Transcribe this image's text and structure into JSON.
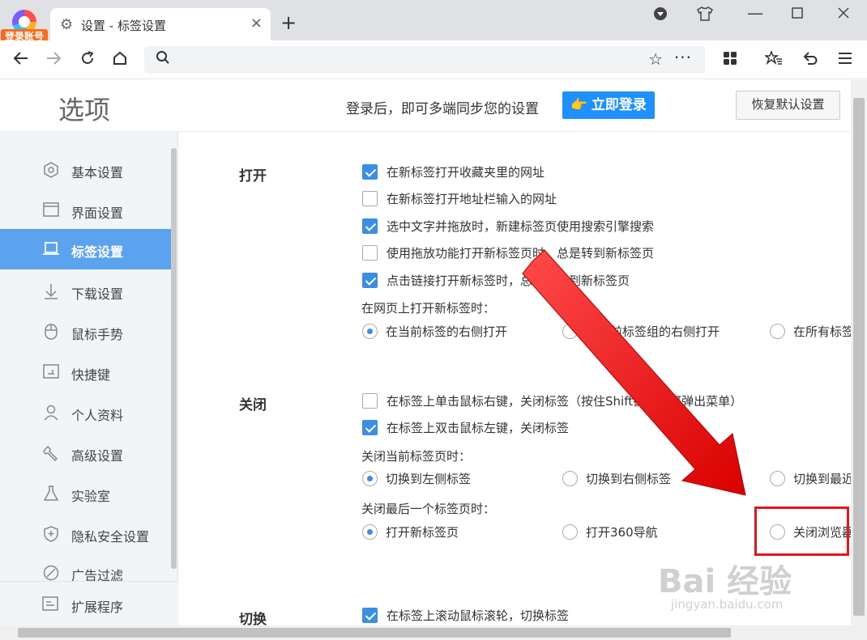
{
  "account": {
    "badge": "登录账号"
  },
  "tab": {
    "title": "设置 - 标签设置",
    "close": "×"
  },
  "newtab": "+",
  "header": {
    "title": "选项",
    "sync_text": "登录后，即可多端同步您的设置",
    "login_button": "👉 立即登录",
    "reset_button": "恢复默认设置"
  },
  "sidebar": {
    "items": [
      {
        "label": "基本设置",
        "icon": "hexagon-gear-icon"
      },
      {
        "label": "界面设置",
        "icon": "window-icon"
      },
      {
        "label": "标签设置",
        "icon": "tab-icon",
        "active": true
      },
      {
        "label": "下载设置",
        "icon": "download-icon"
      },
      {
        "label": "鼠标手势",
        "icon": "mouse-icon"
      },
      {
        "label": "快捷键",
        "icon": "keyboard-icon"
      },
      {
        "label": "个人资料",
        "icon": "person-icon"
      },
      {
        "label": "高级设置",
        "icon": "wrench-icon"
      },
      {
        "label": "实验室",
        "icon": "flask-icon"
      },
      {
        "label": "隐私安全设置",
        "icon": "shield-plus-icon"
      },
      {
        "label": "广告过滤",
        "icon": "block-icon"
      }
    ],
    "extensions": {
      "label": "扩展程序",
      "icon": "extension-icon"
    }
  },
  "sections": {
    "open": {
      "title": "打开",
      "options": [
        {
          "label": "在新标签打开收藏夹里的网址",
          "checked": true
        },
        {
          "label": "在新标签打开地址栏输入的网址",
          "checked": false
        },
        {
          "label": "选中文字并拖放时，新建标签页使用搜索引擎搜索",
          "checked": true
        },
        {
          "label": "使用拖放功能打开新标签页时，总是转到新标签页",
          "checked": false
        },
        {
          "label": "点击链接打开新标签时，总是切换到新标签页",
          "checked": true
        }
      ],
      "position_label": "在网页上打开新标签时：",
      "position_options": [
        {
          "label": "在当前标签的右侧打开",
          "selected": true
        },
        {
          "label": "在当前标签组的右侧打开",
          "selected": false
        },
        {
          "label": "在所有标签",
          "selected": false
        }
      ]
    },
    "close": {
      "title": "关闭",
      "options": [
        {
          "label": "在标签上单击鼠标右键，关闭标签（按住Shift键点击可弹出菜单）",
          "checked": false
        },
        {
          "label": "在标签上双击鼠标左键，关闭标签",
          "checked": true
        }
      ],
      "current_label": "关闭当前标签页时：",
      "current_options": [
        {
          "label": "切换到左侧标签",
          "selected": true
        },
        {
          "label": "切换到右侧标签",
          "selected": false
        },
        {
          "label": "切换到最近",
          "selected": false
        }
      ],
      "last_label": "关闭最后一个标签页时：",
      "last_options": [
        {
          "label": "打开新标签页",
          "selected": true
        },
        {
          "label": "打开360导航",
          "selected": false
        },
        {
          "label": "关闭浏览器",
          "selected": false
        }
      ]
    },
    "switch": {
      "title": "切换",
      "options": [
        {
          "label": "在标签上滚动鼠标滚轮，切换标签",
          "checked": true
        }
      ]
    }
  },
  "watermark": {
    "main": "Bai 经验",
    "sub": "jingyan.baidu.com"
  },
  "colors": {
    "accent": "#3a8ee6",
    "sidebar_active": "#5ba3ef",
    "login": "#1e90ff",
    "annotation": "#e8151b"
  }
}
